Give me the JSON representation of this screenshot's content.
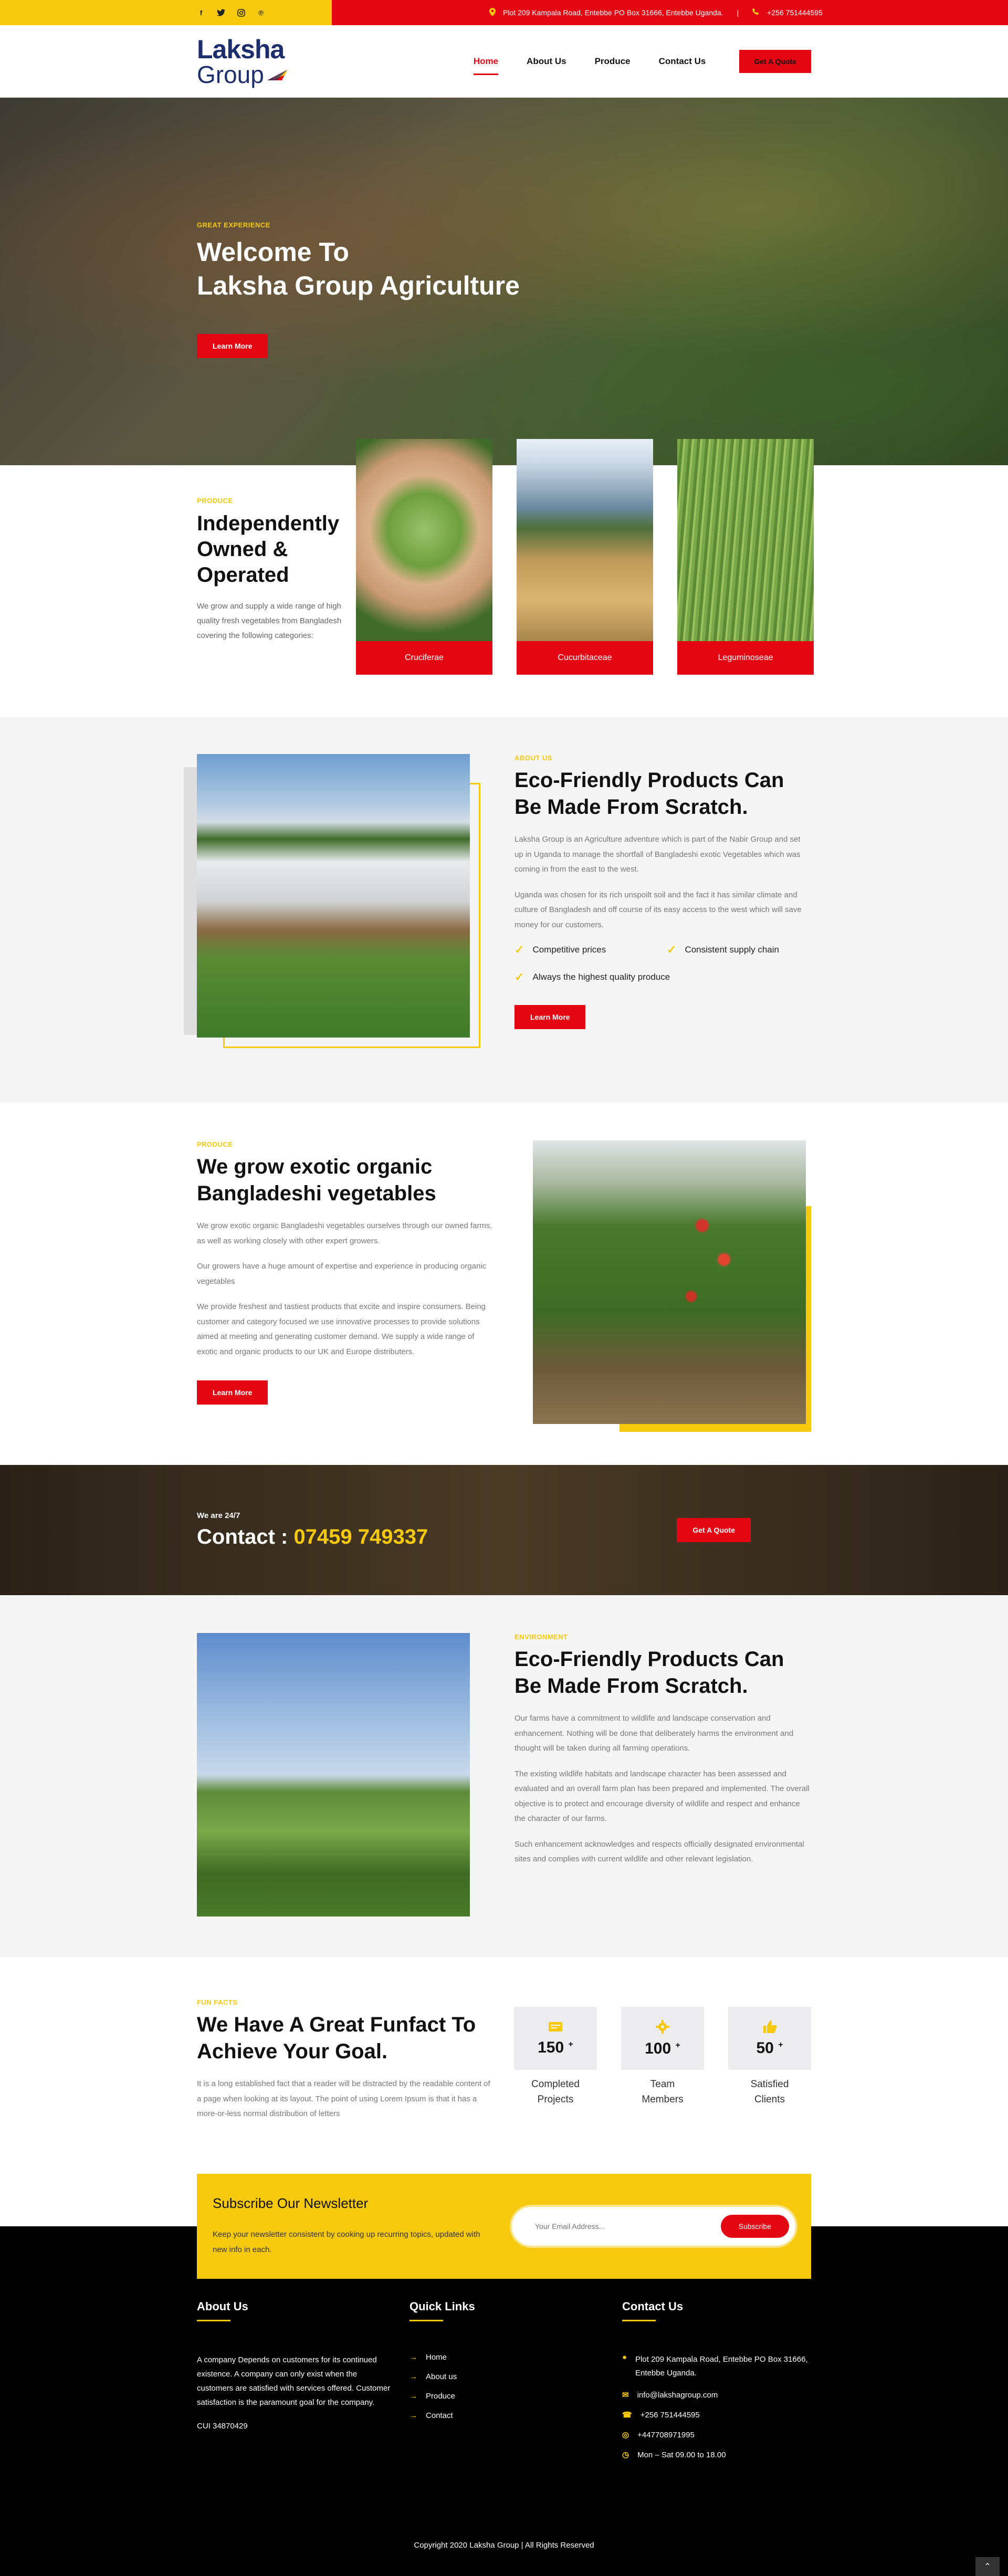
{
  "topbar": {
    "address": "Plot 209 Kampala Road, Entebbe PO Box 31666, Entebbe Uganda.",
    "sep": "|",
    "phone": "+256 751444595",
    "social": [
      "f",
      "t",
      "ig",
      "p"
    ]
  },
  "logo": {
    "line1": "Laksha",
    "line2": "Group"
  },
  "nav": {
    "items": [
      "Home",
      "About Us",
      "Produce",
      "Contact Us"
    ],
    "quote": "Get A Quote"
  },
  "hero": {
    "kicker": "GREAT EXPERIENCE",
    "title1": "Welcome To",
    "title2": "Laksha Group Agriculture",
    "button": "Learn More"
  },
  "produce": {
    "kicker": "PRODUCE",
    "title": "Independently Owned & Operated",
    "text": "We grow and supply a wide range of high quality fresh vegetables from Bangladesh covering the following categories:",
    "cards": [
      "Cruciferae",
      "Cucurbitaceae",
      "Leguminoseae"
    ]
  },
  "about": {
    "kicker": "ABOUT US",
    "title": "Eco-Friendly Products Can Be Made From Scratch.",
    "p1": "Laksha Group is an Agriculture adventure which is part of the Nabir Group and set up in Uganda to manage the shortfall of Bangladeshi exotic Vegetables which was coming in from the east to the west.",
    "p2": "Uganda was chosen for its rich unspoilt soil and the fact it has similar climate and culture of Bangladesh and off course of its easy access to the west which will save money for our customers.",
    "checks": [
      "Competitive prices",
      "Consistent supply chain",
      "Always the highest quality produce"
    ],
    "button": "Learn More"
  },
  "grow": {
    "kicker": "PRODUCE",
    "title": "We grow exotic organic Bangladeshi vegetables",
    "p1": "We grow exotic organic Bangladeshi vegetables ourselves through our owned farms, as well as working closely with other expert growers.",
    "p2": "Our growers have a huge amount of expertise and experience in producing organic vegetables",
    "p3": "We provide freshest and tastiest products that excite and inspire consumers. Being customer and category focused we use innovative processes to provide solutions aimed at meeting and generating customer demand. We supply a wide range of exotic and organic products to our UK and Europe distributers.",
    "button": "Learn More"
  },
  "cta": {
    "small": "We are 24/7",
    "label": "Contact : ",
    "number": "07459 749337",
    "button": "Get A Quote"
  },
  "env": {
    "kicker": "ENVIRONMENT",
    "title": "Eco-Friendly Products Can Be Made From Scratch.",
    "p1": "Our farms have a commitment to wildlife and landscape conservation and enhancement. Nothing will be done that deliberately harms the environment and thought will be taken during all farming operations.",
    "p2": "The existing wildlife habitats and landscape character has been assessed and evaluated and an overall farm plan has been prepared and implemented. The overall objective is to protect and encourage diversity of wildlife and respect and enhance the character of our farms.",
    "p3": "Such enhancement acknowledges and respects officially designated environmental sites and complies with current wildlife and other relevant legislation."
  },
  "fun": {
    "kicker": "FUN FACTS",
    "title": "We Have A Great Funfact To Achieve Your Goal.",
    "text": "It is a long established fact that a reader will be distracted by the readable content of a page when looking at its layout. The point of using Lorem Ipsum is that it has a more-or-less normal distribution of letters",
    "stats": [
      {
        "num": "150",
        "sup": "+",
        "l1": "Completed",
        "l2": "Projects"
      },
      {
        "num": "100",
        "sup": "+",
        "l1": "Team",
        "l2": "Members"
      },
      {
        "num": "50",
        "sup": "+",
        "l1": "Satisfied",
        "l2": "Clients"
      }
    ]
  },
  "newsletter": {
    "title": "Subscribe Our Newsletter",
    "text": "Keep your newsletter consistent by cooking up recurring topics, updated with new info in each.",
    "placeholder": "Your Email Address...",
    "button": "Subscribe"
  },
  "footer": {
    "about_title": "About Us",
    "about_text": "A company Depends on customers for its continued existence. A company can only exist when the customers are satisfied with services offered. Customer satisfaction is the paramount goal for the company.",
    "cui": "CUI 34870429",
    "links_title": "Quick Links",
    "links": [
      "Home",
      "About us",
      "Produce",
      "Contact"
    ],
    "contact_title": "Contact Us",
    "address": "Plot 209 Kampala Road, Entebbe PO Box 31666, Entebbe Uganda.",
    "email": "info@lakshagroup.com",
    "phone": "+256 751444595",
    "whatsapp": "+447708971995",
    "hours": "Mon – Sat 09.00 to 18.00",
    "copyright": "Copyright 2020 Laksha Group | All Rights Reserved"
  }
}
